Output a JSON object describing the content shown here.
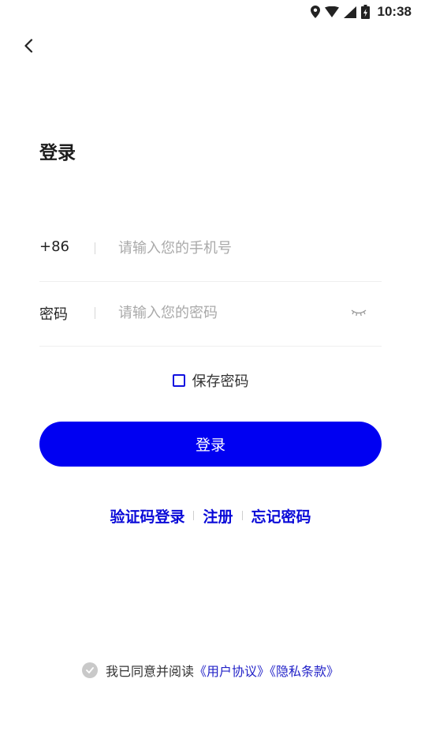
{
  "status_bar": {
    "time": "10:38"
  },
  "title": "登录",
  "phone_field": {
    "country_code": "+86",
    "value": "",
    "placeholder": "请输入您的手机号"
  },
  "password_field": {
    "label": "密码",
    "value": "",
    "placeholder": "请输入您的密码"
  },
  "save_password": {
    "label": "保存密码",
    "checked": false
  },
  "login_button": {
    "label": "登录"
  },
  "links": {
    "sms_login": "验证码登录",
    "register": "注册",
    "forgot_password": "忘记密码"
  },
  "agreement": {
    "prefix": "我已同意并阅读",
    "user_agreement": "《用户协议》",
    "privacy_policy": "《隐私条款》"
  },
  "colors": {
    "primary": "#0000f2",
    "link": "#0a0ad8"
  }
}
